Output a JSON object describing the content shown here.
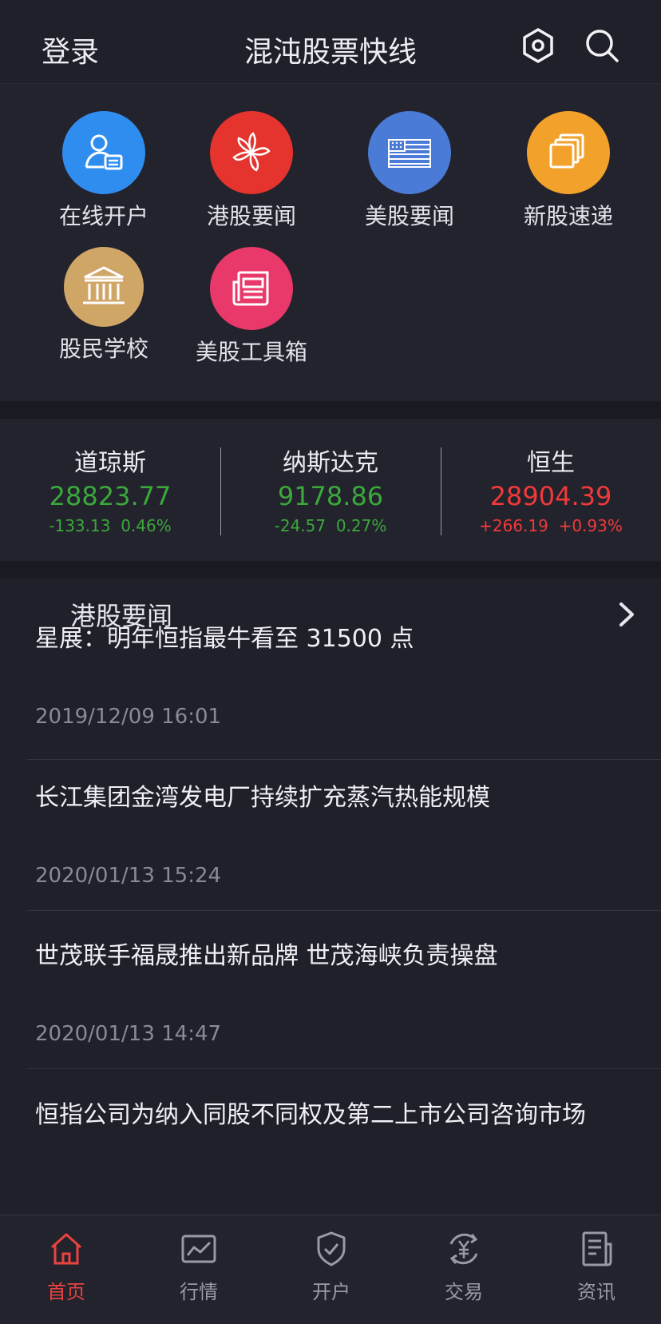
{
  "header": {
    "login_label": "登录",
    "title": "混沌股票快线",
    "icons": [
      "gear-icon",
      "search-icon"
    ]
  },
  "shortcuts": [
    {
      "label": "在线开户",
      "icon": "user-card-icon",
      "color": "#2f8df0"
    },
    {
      "label": "港股要闻",
      "icon": "bauhinia-icon",
      "color": "#e5332e"
    },
    {
      "label": "美股要闻",
      "icon": "us-flag-icon",
      "color": "#4a7bd6"
    },
    {
      "label": "新股速递",
      "icon": "stack-icon",
      "color": "#f2a22a"
    },
    {
      "label": "股民学校",
      "icon": "school-icon",
      "color": "#d0a667"
    },
    {
      "label": "美股工具箱",
      "icon": "newspaper-icon",
      "color": "#e9386a"
    }
  ],
  "indices": [
    {
      "name": "道琼斯",
      "value": "28823.77",
      "change": "-133.13",
      "pct": "0.46%",
      "trend": "down"
    },
    {
      "name": "纳斯达克",
      "value": "9178.86",
      "change": "-24.57",
      "pct": "0.27%",
      "trend": "down"
    },
    {
      "name": "恒生",
      "value": "28904.39",
      "change": "+266.19",
      "pct": "+0.93%",
      "trend": "up"
    }
  ],
  "news": {
    "section_title": "港股要闻",
    "items": [
      {
        "headline": "星展：明年恒指最牛看至 31500 点",
        "time": "2019/12/09 16:01"
      },
      {
        "headline": "长江集团金湾发电厂持续扩充蒸汽热能规模",
        "time": "2020/01/13 15:24"
      },
      {
        "headline": "世茂联手福晟推出新品牌 世茂海峡负责操盘",
        "time": "2020/01/13 14:47"
      },
      {
        "headline": "恒指公司为纳入同股不同权及第二上市公司咨询市场",
        "time": ""
      }
    ]
  },
  "tabs": [
    {
      "label": "首页",
      "icon": "home-icon",
      "active": true
    },
    {
      "label": "行情",
      "icon": "chart-icon",
      "active": false
    },
    {
      "label": "开户",
      "icon": "shield-icon",
      "active": false
    },
    {
      "label": "交易",
      "icon": "yen-exchange-icon",
      "active": false
    },
    {
      "label": "资讯",
      "icon": "document-icon",
      "active": false
    }
  ],
  "colors": {
    "accent": "#e8433f",
    "up": "#f03a3a",
    "down": "#3ba83b"
  }
}
